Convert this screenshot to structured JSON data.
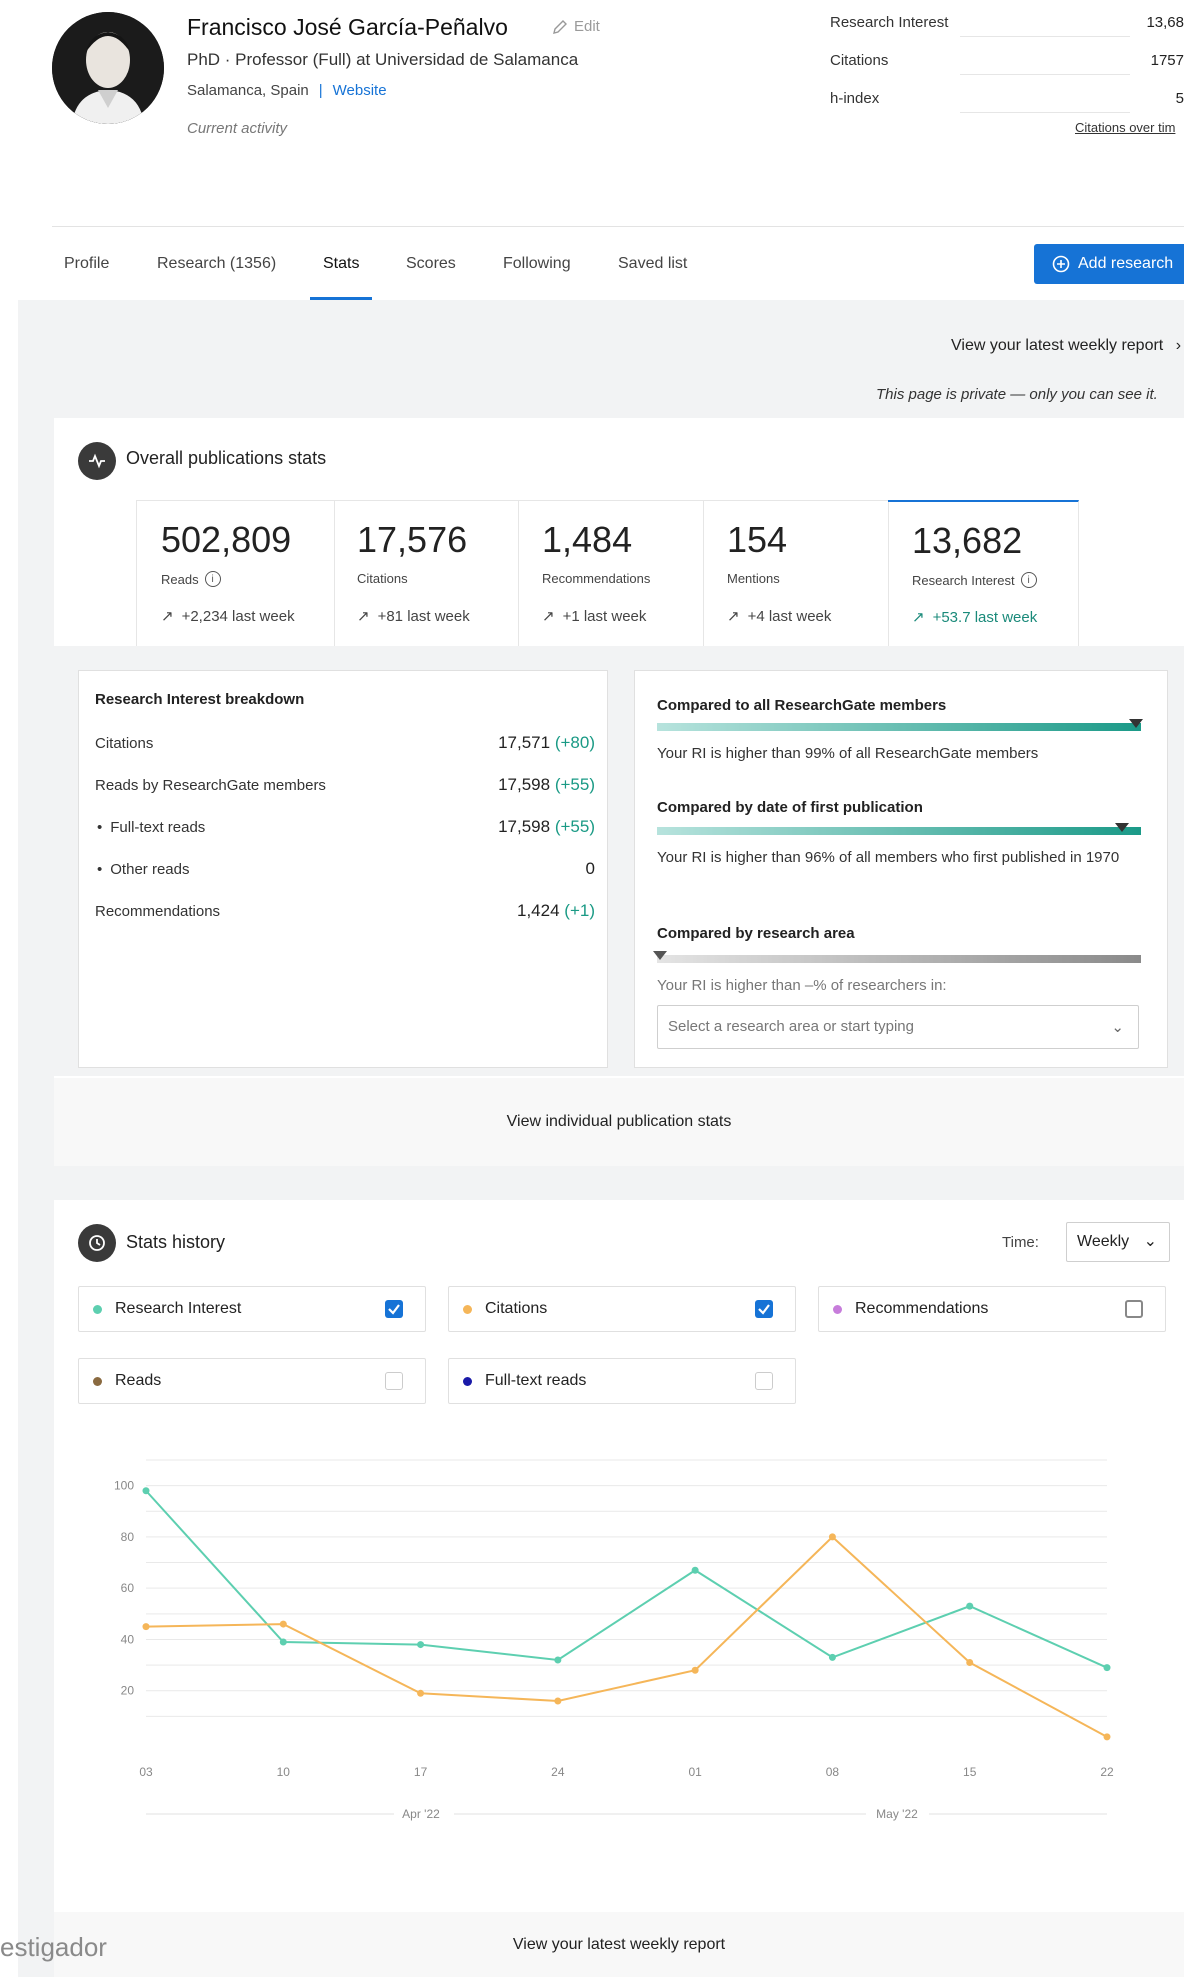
{
  "profile": {
    "name": "Francisco José García-Peñalvo",
    "edit_label": "Edit",
    "degree": "PhD · Professor (Full) at Universidad de Salamanca",
    "location": "Salamanca, Spain",
    "website_label": "Website",
    "current_activity": "Current activity"
  },
  "header_stats": [
    {
      "label": "Research Interest",
      "value": "13,68"
    },
    {
      "label": "Citations",
      "value": "1757"
    },
    {
      "label": "h-index",
      "value": "5"
    }
  ],
  "citations_over_time": "Citations over tim",
  "tabs": [
    {
      "label": "Profile"
    },
    {
      "label": "Research (1356)"
    },
    {
      "label": "Stats"
    },
    {
      "label": "Scores"
    },
    {
      "label": "Following"
    },
    {
      "label": "Saved list"
    }
  ],
  "active_tab": "Stats",
  "add_research_label": "Add research",
  "weekly_report_top": "View your latest weekly report",
  "private_note": "This page is private — only you can see it.",
  "overall": {
    "title": "Overall publications stats",
    "stats": [
      {
        "value": "502,809",
        "label": "Reads",
        "week": "+2,234 last week"
      },
      {
        "value": "17,576",
        "label": "Citations",
        "week": "+81 last week"
      },
      {
        "value": "1,484",
        "label": "Recommendations",
        "week": "+1 last week"
      },
      {
        "value": "154",
        "label": "Mentions",
        "week": "+4 last week"
      },
      {
        "value": "13,682",
        "label": "Research Interest",
        "week": "+53.7 last week"
      }
    ]
  },
  "breakdown": {
    "title": "Research Interest breakdown",
    "rows": [
      {
        "label": "Citations",
        "value": "17,571",
        "delta": "(+80)"
      },
      {
        "label": "Reads by ResearchGate members",
        "value": "17,598",
        "delta": "(+55)"
      },
      {
        "label": "Full-text reads",
        "value": "17,598",
        "delta": "(+55)"
      },
      {
        "label": "Other reads",
        "value": "0",
        "delta": ""
      },
      {
        "label": "Recommendations",
        "value": "1,424",
        "delta": "(+1)"
      }
    ]
  },
  "comparison": {
    "all_title": "Compared to all ResearchGate members",
    "all_text": "Your RI is higher than 99% of all ResearchGate members",
    "all_level": 0.99,
    "date_title": "Compared by date of first publication",
    "date_text": "Your RI is higher than 96% of all members who first published in 1970",
    "date_level": 0.96,
    "area_title": "Compared by research area",
    "area_text": "Your RI is higher than –% of researchers in:",
    "area_placeholder": "Select a research area or start typing"
  },
  "view_individual": "View individual publication stats",
  "history": {
    "title": "Stats history",
    "time_label": "Time:",
    "time_value": "Weekly",
    "legend": [
      {
        "label": "Research Interest",
        "color": "#5dcfb0",
        "checked": true
      },
      {
        "label": "Citations",
        "color": "#f5b659",
        "checked": true
      },
      {
        "label": "Recommendations",
        "color": "#c77ddb",
        "checked": false
      },
      {
        "label": "Reads",
        "color": "#8a6a40",
        "checked": false
      },
      {
        "label": "Full-text reads",
        "color": "#1a1aa8",
        "checked": false
      }
    ]
  },
  "chart_data": {
    "type": "line",
    "x": [
      "03",
      "10",
      "17",
      "24",
      "01",
      "08",
      "15",
      "22"
    ],
    "month_labels": [
      "Apr '22",
      "May '22"
    ],
    "yticks": [
      "100",
      "80",
      "60",
      "40",
      "20"
    ],
    "ylim": [
      0,
      110
    ],
    "series": [
      {
        "name": "Research Interest",
        "color": "#5dcfb0",
        "values": [
          98,
          39,
          38,
          32,
          67,
          33,
          53,
          29
        ]
      },
      {
        "name": "Citations",
        "color": "#f5b659",
        "values": [
          45,
          46,
          19,
          16,
          28,
          80,
          31,
          2
        ]
      }
    ]
  },
  "weekly_report_bottom": "View your latest weekly report",
  "watermark": "estigador"
}
